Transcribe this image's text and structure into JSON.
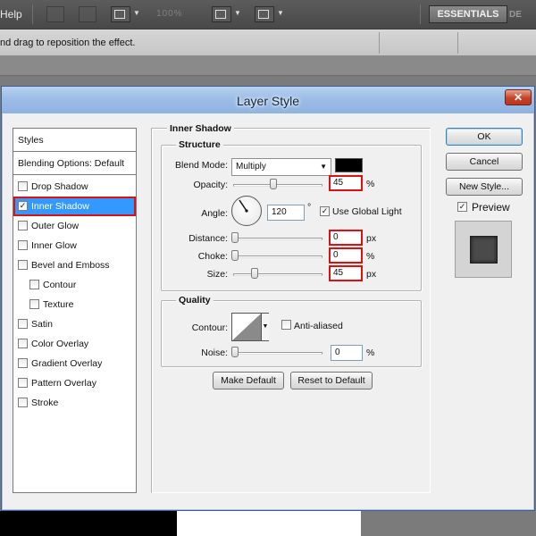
{
  "app": {
    "menu_help": "Help",
    "zoom_ghost": "100%",
    "workspace": "ESSENTIALS",
    "workspace_next": "DE",
    "options_hint": "nd drag to reposition the effect."
  },
  "dialog": {
    "title": "Layer Style",
    "close_glyph": "✕"
  },
  "styles_list": {
    "styles_header": "Styles",
    "blending_options": "Blending Options: Default",
    "items": [
      {
        "label": "Drop Shadow",
        "checked": false
      },
      {
        "label": "Inner Shadow",
        "checked": true,
        "selected": true
      },
      {
        "label": "Outer Glow",
        "checked": false
      },
      {
        "label": "Inner Glow",
        "checked": false
      },
      {
        "label": "Bevel and Emboss",
        "checked": false
      },
      {
        "label": "Contour",
        "checked": false,
        "indent": true
      },
      {
        "label": "Texture",
        "checked": false,
        "indent": true
      },
      {
        "label": "Satin",
        "checked": false
      },
      {
        "label": "Color Overlay",
        "checked": false
      },
      {
        "label": "Gradient Overlay",
        "checked": false
      },
      {
        "label": "Pattern Overlay",
        "checked": false
      },
      {
        "label": "Stroke",
        "checked": false
      }
    ]
  },
  "inner_shadow": {
    "panel_title": "Inner Shadow",
    "structure": {
      "title": "Structure",
      "blend_mode_label": "Blend Mode:",
      "blend_mode_value": "Multiply",
      "shadow_color": "#000000",
      "opacity_label": "Opacity:",
      "opacity_value": "45",
      "opacity_unit": "%",
      "opacity_level": 0.45,
      "angle_label": "Angle:",
      "angle_value": "120",
      "angle_unit": "°",
      "use_global_light_label": "Use Global Light",
      "use_global_light": true,
      "distance_label": "Distance:",
      "distance_value": "0",
      "distance_unit": "px",
      "choke_label": "Choke:",
      "choke_value": "0",
      "choke_unit": "%",
      "size_label": "Size:",
      "size_value": "45",
      "size_unit": "px"
    },
    "quality": {
      "title": "Quality",
      "contour_label": "Contour:",
      "anti_aliased_label": "Anti-aliased",
      "anti_aliased": false,
      "noise_label": "Noise:",
      "noise_value": "0",
      "noise_unit": "%"
    },
    "make_default": "Make Default",
    "reset_to_default": "Reset to Default"
  },
  "actions": {
    "ok": "OK",
    "cancel": "Cancel",
    "new_style": "New Style...",
    "preview_label": "Preview",
    "preview": true
  }
}
